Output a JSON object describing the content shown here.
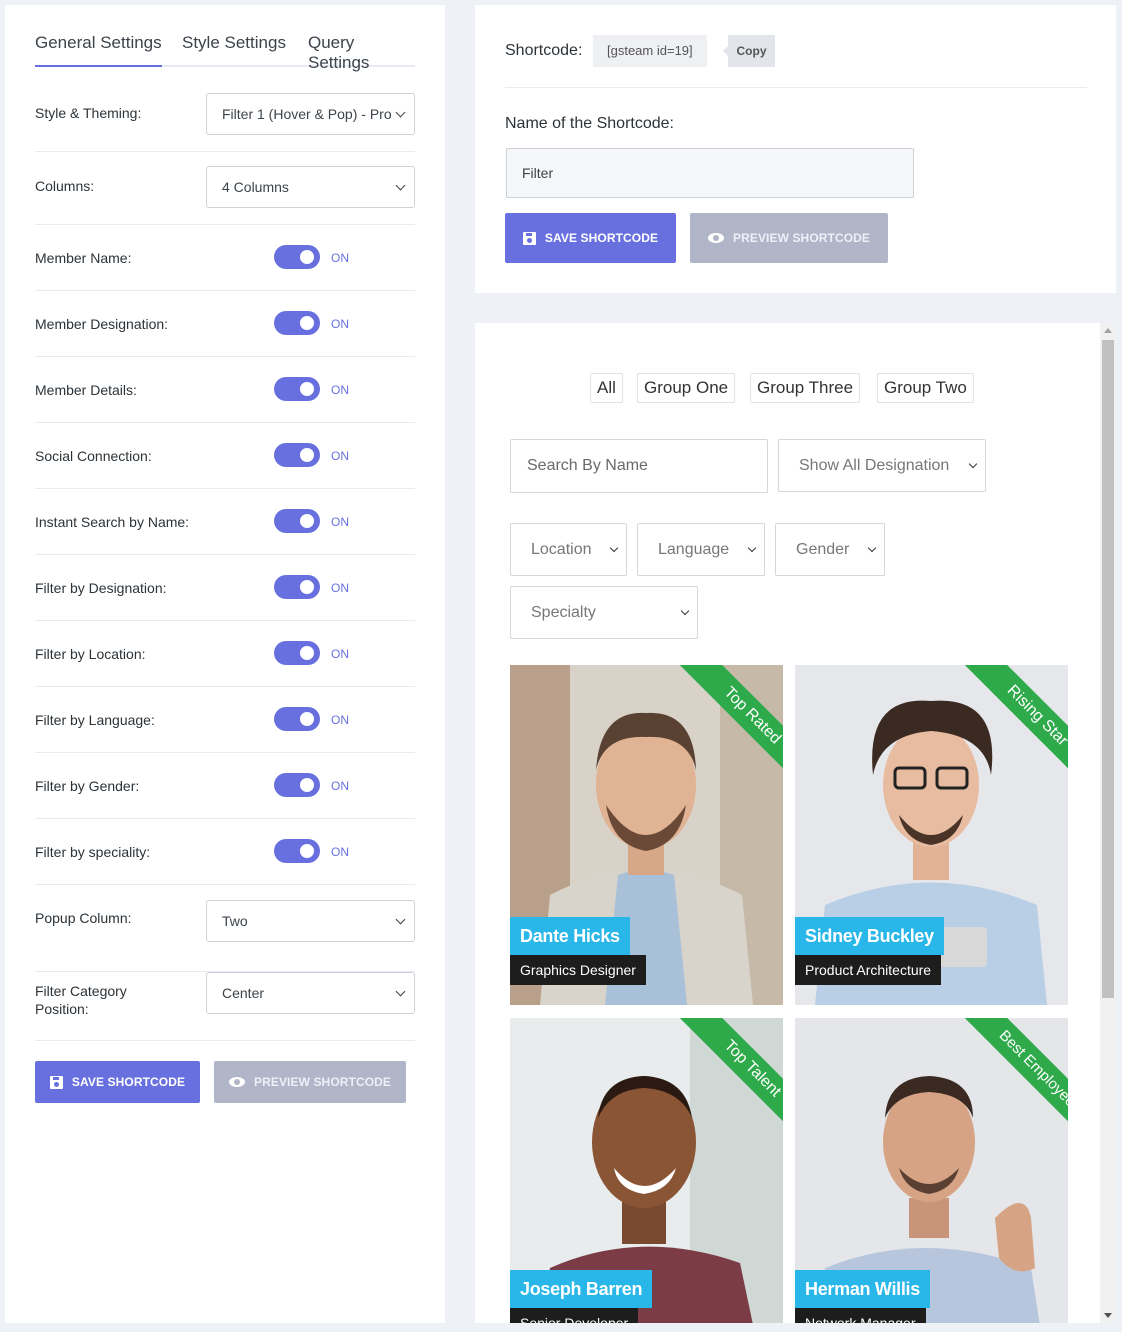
{
  "left": {
    "tabs": [
      {
        "label": "General Settings"
      },
      {
        "label": "Style Settings"
      },
      {
        "label": "Query Settings"
      }
    ],
    "style_theming": {
      "label": "Style & Theming:",
      "value": "Filter 1 (Hover & Pop) - Pro"
    },
    "columns": {
      "label": "Columns:",
      "value": "4 Columns"
    },
    "toggles": [
      {
        "label": "Member Name:",
        "state": "ON"
      },
      {
        "label": "Member Designation:",
        "state": "ON"
      },
      {
        "label": "Member Details:",
        "state": "ON"
      },
      {
        "label": "Social Connection:",
        "state": "ON"
      },
      {
        "label": "Instant Search by Name:",
        "state": "ON"
      },
      {
        "label": "Filter by Designation:",
        "state": "ON"
      },
      {
        "label": "Filter by Location:",
        "state": "ON"
      },
      {
        "label": "Filter by Language:",
        "state": "ON"
      },
      {
        "label": "Filter by Gender:",
        "state": "ON"
      },
      {
        "label": "Filter by speciality:",
        "state": "ON"
      }
    ],
    "popup_column": {
      "label": "Popup Column:",
      "value": "Two"
    },
    "filter_category_position": {
      "label": "Filter Category Position:",
      "value": "Center"
    },
    "save_label": "SAVE SHORTCODE",
    "preview_label": "PREVIEW SHORTCODE"
  },
  "shortcode": {
    "label": "Shortcode:",
    "code": "[gsteam id=19]",
    "copy_label": "Copy",
    "name_label": "Name of the Shortcode:",
    "name_value": "Filter",
    "save_label": "SAVE SHORTCODE",
    "preview_label": "PREVIEW SHORTCODE"
  },
  "preview": {
    "filter_buttons": [
      "All",
      "Group One",
      "Group Three",
      "Group Two"
    ],
    "search_placeholder": "Search By Name",
    "designation_select": "Show All Designation",
    "location_select": "Location",
    "language_select": "Language",
    "gender_select": "Gender",
    "specialty_select": "Specialty",
    "members": [
      {
        "name": "Dante Hicks",
        "role": "Graphics Designer",
        "ribbon": "Top Rated"
      },
      {
        "name": "Sidney Buckley",
        "role": "Product Architecture",
        "ribbon": "Rising Star"
      },
      {
        "name": "Joseph Barren",
        "role": "Senior Developer",
        "ribbon": "Top Talent"
      },
      {
        "name": "Herman Willis",
        "role": "Network Manager",
        "ribbon": "Best Employee"
      }
    ]
  },
  "colors": {
    "accent": "#6870e0",
    "ribbon": "#2eaa4a",
    "name_tag": "#29b6e8"
  }
}
